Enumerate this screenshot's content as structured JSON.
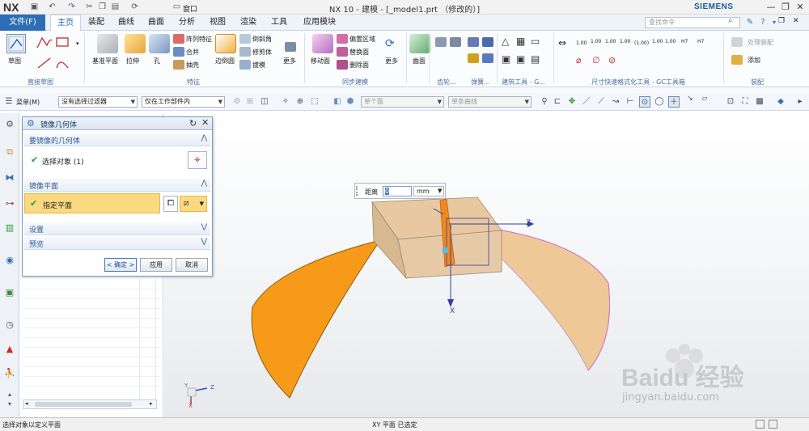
{
  "titlebar": {
    "logo": "NX",
    "title": "NX 10 - 建模 - [_model1.prt （修改的）]",
    "brand": "SIEMENS",
    "window_label": "窗口"
  },
  "menu": {
    "file": "文件(F)",
    "tabs": [
      "主页",
      "装配",
      "曲线",
      "曲面",
      "分析",
      "视图",
      "渲染",
      "工具",
      "应用模块"
    ],
    "search_placeholder": "查找命令"
  },
  "ribbon": {
    "groups": {
      "sketch": "直接草图",
      "feature": "特征",
      "sync": "同步建模",
      "gear": "齿轮...",
      "spring": "弹簧...",
      "tools": "建筑工具 - G...",
      "dims": "尺寸快速格式化工具 - GC工具箱",
      "assembly": "装配"
    },
    "buttons": {
      "sketch": "草图",
      "datum_plane": "基准平面",
      "extrude": "拉伸",
      "hole": "孔",
      "pattern_feature": "阵列特征",
      "unite": "合并",
      "shell": "抽壳",
      "edge_blend": "边倒圆",
      "chamfer": "倒斜角",
      "trim_body": "修剪体",
      "draft": "拔模",
      "more1": "更多",
      "move_face": "移动面",
      "offset_region": "偏置区域",
      "replace_face": "替换面",
      "delete_face": "删除面",
      "more2": "更多",
      "surface": "曲面",
      "process_part": "处理装配",
      "add": "添加"
    },
    "dim_labels": [
      "1.00",
      "1.00",
      "1.00",
      "1.00",
      "(1.00)",
      "1.00",
      "1.00",
      "H7",
      "H7"
    ]
  },
  "selbar": {
    "menu": "菜单(M)",
    "filter": "没有选择过滤器",
    "scope": "仅在工作部件内",
    "face_rule": "单个面",
    "curve_rule": "单条曲线"
  },
  "dialog": {
    "title": "镜像几何体",
    "section_geometry": "要镜像的几何体",
    "select_object": "选择对象 (1)",
    "section_plane": "镜像平面",
    "specify_plane": "指定平面",
    "section_settings": "设置",
    "section_preview": "预览",
    "ok": "< 确定 >",
    "apply": "应用",
    "cancel": "取消"
  },
  "distance": {
    "label": "距离",
    "value": "0",
    "unit": "mm"
  },
  "axes": {
    "x": "X",
    "z": "Z",
    "y": "Y"
  },
  "watermark": {
    "brand": "Baidu 经验",
    "url": "jingyan.baidu.com"
  },
  "status": {
    "left": "选择对象以定义平面",
    "center": "XY 平面 已选定"
  },
  "colors": {
    "accent": "#2d6db5",
    "solid_orange": "#f79a1a",
    "preview_orange": "#efc898",
    "highlight": "#fad980"
  }
}
